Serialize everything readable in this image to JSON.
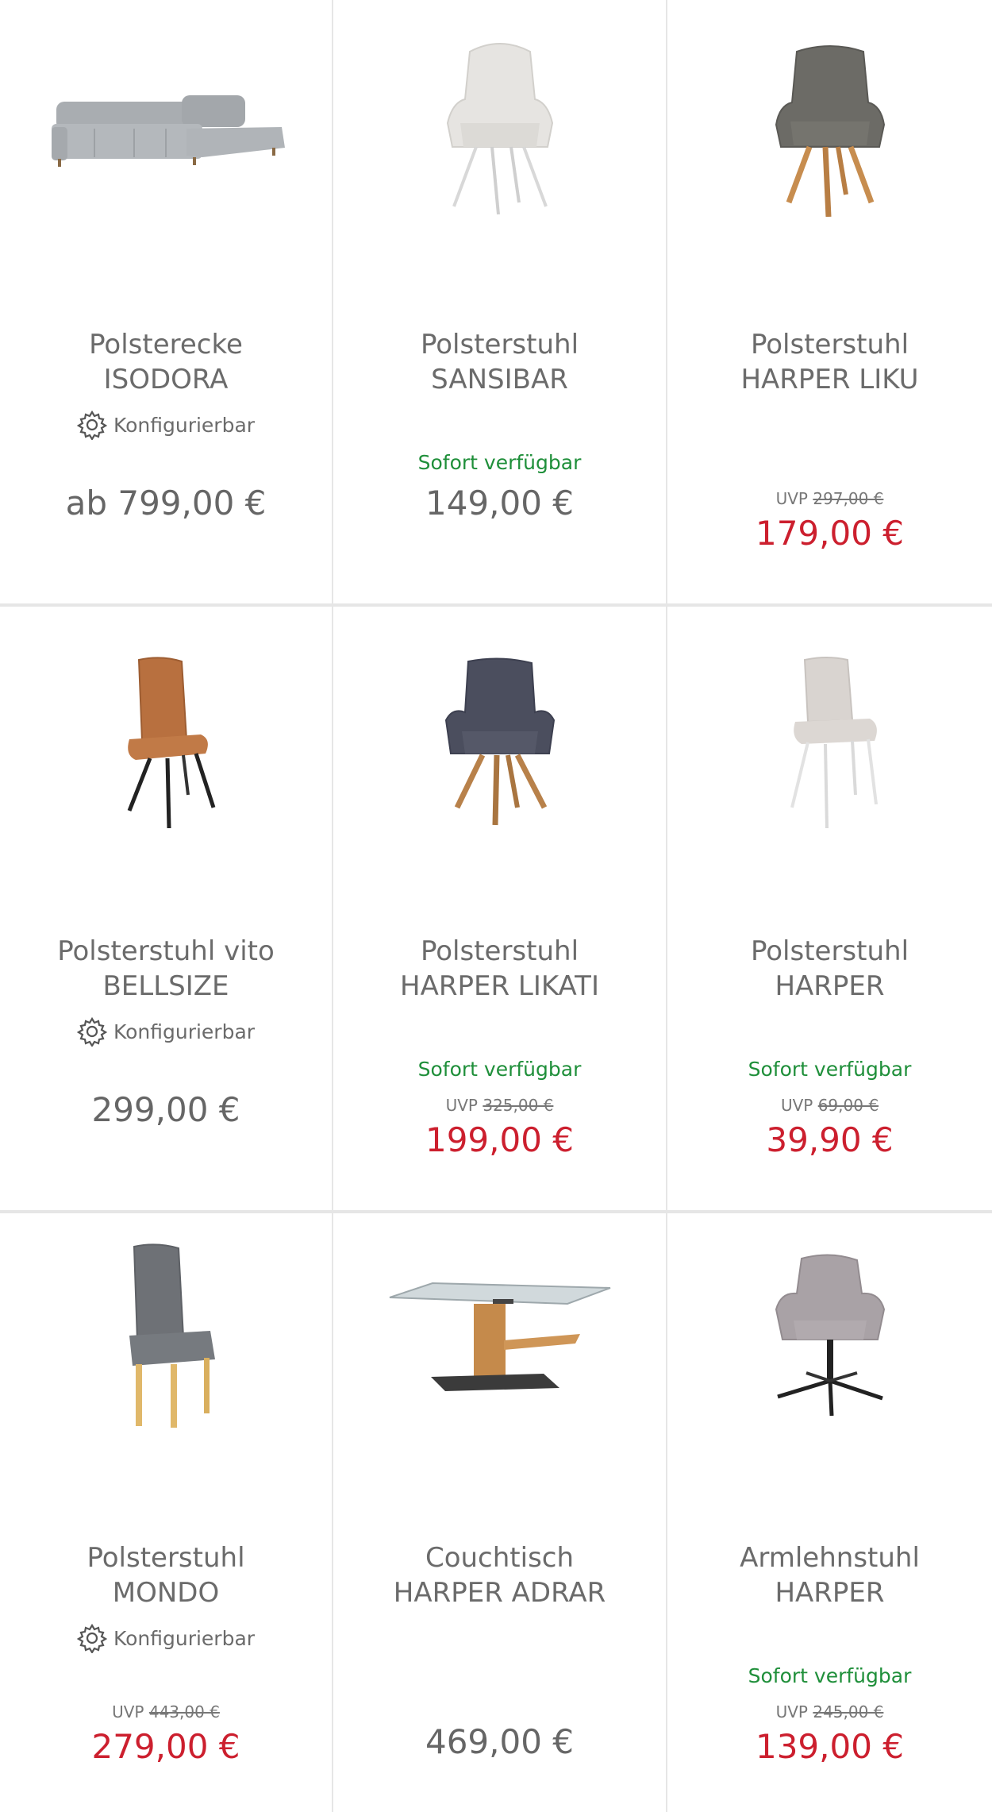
{
  "products": [
    {
      "title_line1": "Polsterecke",
      "title_line2": "ISODORA",
      "configurable_label": "Konfigurierbar",
      "price": "ab 799,00 €",
      "image": "corner-sofa-image"
    },
    {
      "title_line1": "Polsterstuhl",
      "title_line2": "SANSIBAR",
      "availability": "Sofort verfügbar",
      "price": "149,00 €",
      "image": "white-armchair-image"
    },
    {
      "title_line1": "Polsterstuhl",
      "title_line2": "HARPER LIKU",
      "uvp_label": "UVP",
      "uvp_price": "297,00 €",
      "sale_price": "179,00 €",
      "image": "grey-armchair-wood-legs-image"
    },
    {
      "title_line1": "Polsterstuhl vito",
      "title_line2": "BELLSIZE",
      "configurable_label": "Konfigurierbar",
      "price": "299,00 €",
      "image": "cognac-leather-chair-image"
    },
    {
      "title_line1": "Polsterstuhl",
      "title_line2": "HARPER LIKATI",
      "availability": "Sofort verfügbar",
      "uvp_label": "UVP",
      "uvp_price": "325,00 €",
      "sale_price": "199,00 €",
      "image": "dark-blue-armchair-image"
    },
    {
      "title_line1": "Polsterstuhl",
      "title_line2": "HARPER",
      "availability": "Sofort verfügbar",
      "uvp_label": "UVP",
      "uvp_price": "69,00 €",
      "sale_price": "39,90 €",
      "image": "light-grey-chair-image"
    },
    {
      "title_line1": "Polsterstuhl",
      "title_line2": "MONDO",
      "configurable_label": "Konfigurierbar",
      "uvp_label": "UVP",
      "uvp_price": "443,00 €",
      "sale_price": "279,00 €",
      "image": "grey-upholstered-chair-image"
    },
    {
      "title_line1": "Couchtisch",
      "title_line2": "HARPER ADRAR",
      "price": "469,00 €",
      "image": "glass-coffee-table-image"
    },
    {
      "title_line1": "Armlehnstuhl",
      "title_line2": "HARPER",
      "availability": "Sofort verfügbar",
      "uvp_label": "UVP",
      "uvp_price": "245,00 €",
      "sale_price": "139,00 €",
      "image": "swivel-armchair-image"
    }
  ],
  "colors": {
    "availability": "#1f8f3a",
    "sale_price": "#cc1f2e",
    "text": "#666666",
    "divider": "#e6e6e6"
  }
}
